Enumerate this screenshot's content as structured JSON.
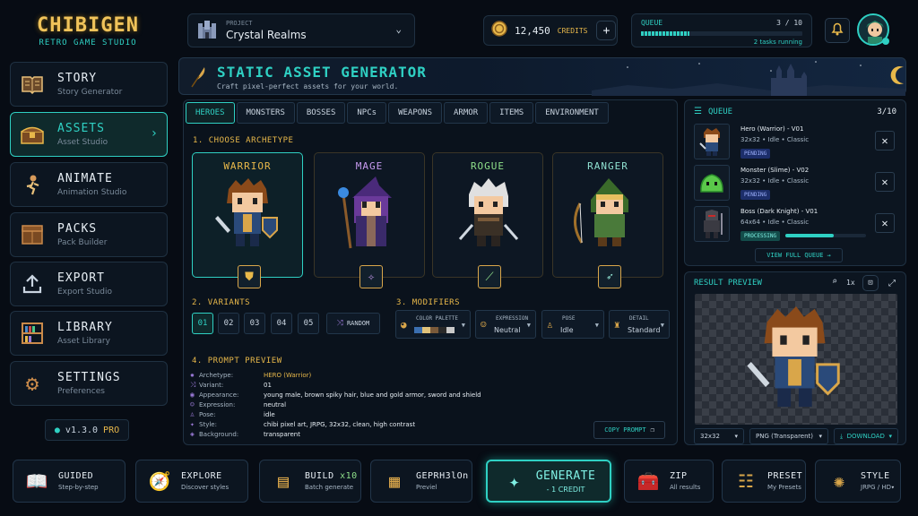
{
  "logo": {
    "title": "CHIBIGEN",
    "subtitle": "RETRO GAME STUDIO"
  },
  "sidebar": {
    "items": [
      {
        "label": "STORY",
        "sub": "Story Generator",
        "icon": "book-icon"
      },
      {
        "label": "ASSETS",
        "sub": "Asset Studio",
        "icon": "chest-icon",
        "active": true
      },
      {
        "label": "ANIMATE",
        "sub": "Animation Studio",
        "icon": "running-figure-icon"
      },
      {
        "label": "PACKS",
        "sub": "Pack Builder",
        "icon": "crate-icon"
      },
      {
        "label": "EXPORT",
        "sub": "Export Studio",
        "icon": "upload-icon"
      },
      {
        "label": "LIBRARY",
        "sub": "Asset Library",
        "icon": "bookshelf-icon"
      },
      {
        "label": "SETTINGS",
        "sub": "Preferences",
        "icon": "gear-icon"
      }
    ],
    "version": "v1.3.0",
    "plan": "PRO"
  },
  "topbar": {
    "project_label": "PROJECT",
    "project_name": "Crystal Realms",
    "credits": "12,450",
    "credits_label": "CREDITS",
    "queue_label": "QUEUE",
    "queue_count": "3 / 10",
    "queue_status": "2 tasks running"
  },
  "banner": {
    "title": "STATIC ASSET GENERATOR",
    "subtitle": "Craft pixel-perfect assets for your world."
  },
  "tabs": [
    "HEROES",
    "MONSTERS",
    "BOSSES",
    "NPCs",
    "WEAPONS",
    "ARMOR",
    "ITEMS",
    "ENVIRONMENT"
  ],
  "archetype": {
    "title": "1. CHOOSE ARCHETYPE",
    "options": [
      {
        "name": "WARRIOR",
        "icon": "shield-icon",
        "active": true,
        "color": "#e8b84a"
      },
      {
        "name": "MAGE",
        "icon": "magic-circle-icon",
        "color": "#c79bf0"
      },
      {
        "name": "ROGUE",
        "icon": "dagger-icon",
        "color": "#8fe08a"
      },
      {
        "name": "RANGER",
        "icon": "bow-icon",
        "color": "#8fe0d0"
      }
    ]
  },
  "variants": {
    "title": "2. VARIANTS",
    "options": [
      "01",
      "02",
      "03",
      "04",
      "05"
    ],
    "random_label": "RANDOM"
  },
  "modifiers": {
    "title": "3. MODIFIERS",
    "color_palette": {
      "label": "COLOR PALETTE",
      "swatches": [
        "#3b6fb0",
        "#e0c27a",
        "#7a5a3a",
        "#2a2a2a",
        "#c9c9c9"
      ]
    },
    "expression": {
      "label": "EXPRESSION",
      "value": "Neutral"
    },
    "pose": {
      "label": "POSE",
      "value": "Idle"
    },
    "detail": {
      "label": "DETAIL",
      "value": "Standard"
    }
  },
  "prompt": {
    "title": "4. PROMPT PREVIEW",
    "rows": [
      {
        "key": "Archetype:",
        "value": "HERO (Warrior)"
      },
      {
        "key": "Variant:",
        "value": "01"
      },
      {
        "key": "Appearance:",
        "value": "young male, brown spiky hair, blue and gold armor, sword and shield"
      },
      {
        "key": "Expression:",
        "value": "neutral"
      },
      {
        "key": "Pose:",
        "value": "idle"
      },
      {
        "key": "Style:",
        "value": "chibi pixel art, JRPG, 32x32, clean, high contrast"
      },
      {
        "key": "Background:",
        "value": "transparent"
      }
    ],
    "copy_label": "COPY PROMPT"
  },
  "queue": {
    "title": "QUEUE",
    "count": "3/10",
    "items": [
      {
        "title": "Hero (Warrior) - V01",
        "meta": "32x32  •  Idle  •  Classic",
        "status": "PENDING"
      },
      {
        "title": "Monster (Slime) - V02",
        "meta": "32x32  •  Idle  •  Classic",
        "status": "PENDING"
      },
      {
        "title": "Boss (Dark Knight) - V01",
        "meta": "64x64  •  Idle  •  Classic",
        "status": "PROCESSING",
        "progress": 0.6
      }
    ],
    "view_full": "VIEW FULL QUEUE"
  },
  "result": {
    "title": "RESULT PREVIEW",
    "zoom": "1x",
    "size": "32x32",
    "format": "PNG (Transparent)",
    "download": "DOWNLOAD"
  },
  "bottom": {
    "guided": {
      "label": "GUIDED",
      "sub": "Step-by-step"
    },
    "explore": {
      "label": "EXPLORE",
      "sub": "Discover styles"
    },
    "build": {
      "label": "BUILD",
      "mult": "x10",
      "sub": "Batch generate"
    },
    "gen2": {
      "label": "GEPRH3lOn",
      "sub": "Previel"
    },
    "generate": {
      "label": "GENERATE",
      "sub": "- 1 CREDIT"
    },
    "zip": {
      "label": "ZIP",
      "sub": "All results"
    },
    "preset": {
      "label": "PRESET",
      "sub": "My Presets"
    },
    "style": {
      "label": "STYLE",
      "sub": "JRPG / HD"
    }
  }
}
